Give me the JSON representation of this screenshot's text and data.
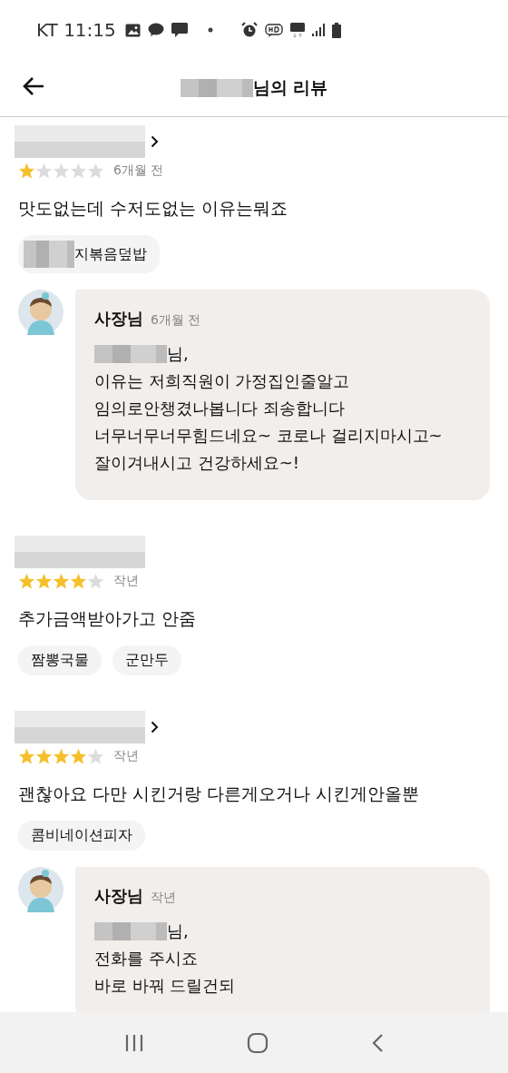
{
  "status_bar": {
    "carrier": "KT",
    "time": "11:15"
  },
  "header": {
    "title": "님의 리뷰"
  },
  "reviews": [
    {
      "show_arrow": true,
      "stars": 1,
      "time": "6개월 전",
      "text": "맛도없는데 수저도없는 이유는뭐죠",
      "menu": [
        {
          "label": "지볶음덮밥",
          "redacted": true
        }
      ],
      "reply": {
        "author": "사장님",
        "time": "6개월 전",
        "greeting": "님,",
        "lines": [
          "이유는 저희직원이 가정집인줄알고",
          "임의로안챙겼나봅니다 죄송합니다",
          "너무너무너무힘드네요~ 코로나 걸리지마시고~",
          "잘이겨내시고 건강하세요~!"
        ]
      }
    },
    {
      "show_arrow": false,
      "stars": 4,
      "time": "작년",
      "text": "추가금액받아가고 안줌",
      "menu": [
        {
          "label": "짬뽕국물",
          "redacted": false
        },
        {
          "label": "군만두",
          "redacted": false
        }
      ]
    },
    {
      "show_arrow": true,
      "stars": 4,
      "time": "작년",
      "text": "괜찮아요 다만 시킨거랑 다른게오거나 시킨게안올뿐",
      "menu": [
        {
          "label": "콤비네이션피자",
          "redacted": false
        }
      ],
      "reply": {
        "author": "사장님",
        "time": "작년",
        "greeting": "님,",
        "lines": [
          "전화를  주시죠",
          "바로 바꿔 드릴건되"
        ]
      }
    }
  ]
}
